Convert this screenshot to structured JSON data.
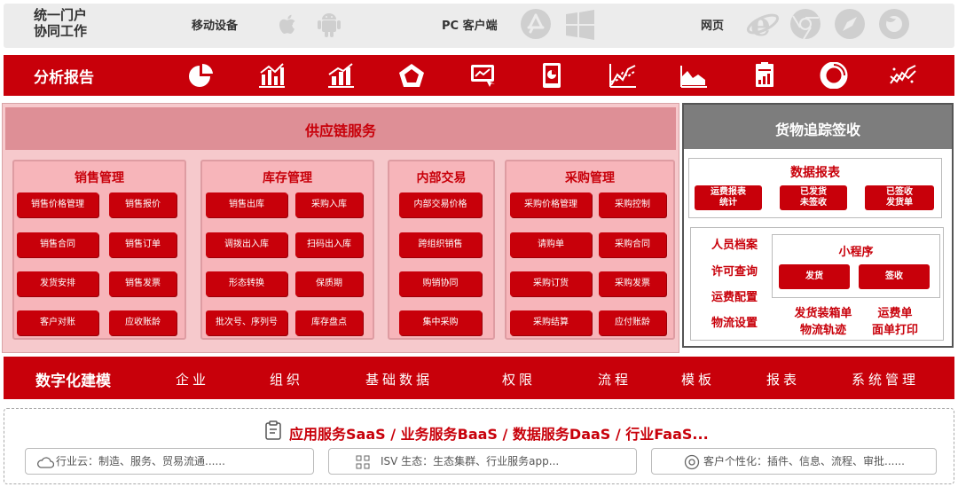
{
  "portal": {
    "title_line1": "统一门户",
    "title_line2": "协同工作",
    "categories": [
      {
        "label": "移动设备",
        "icons": [
          "apple-icon",
          "android-icon"
        ]
      },
      {
        "label": "PC 客户端",
        "icons": [
          "app-store-icon",
          "windows-icon"
        ]
      },
      {
        "label": "网页",
        "icons": [
          "ie-icon",
          "chrome-icon",
          "safari-icon",
          "firefox-icon"
        ]
      }
    ]
  },
  "analysis": {
    "title": "分析报告",
    "icons": [
      "pie-chart-icon",
      "bar-line-icon",
      "bar-trend-icon",
      "radar-chart-icon",
      "dashboard-screen-icon",
      "tablet-chart-icon",
      "multi-line-chart-icon",
      "area-chart-icon",
      "report-doc-icon",
      "ring-chart-icon",
      "scatter-line-icon"
    ]
  },
  "supply_chain": {
    "title": "供应链服务",
    "groups": [
      {
        "title": "销售管理",
        "items": [
          "销售价格管理",
          "销售报价",
          "销售合同",
          "销售订单",
          "发货安排",
          "销售发票",
          "客户对账",
          "应收账龄"
        ]
      },
      {
        "title": "库存管理",
        "items": [
          "销售出库",
          "采购入库",
          "调拨出入库",
          "扫码出入库",
          "形态转换",
          "保质期",
          "批次号、序列号",
          "库存盘点"
        ]
      },
      {
        "title": "内部交易",
        "items": [
          "内部交易价格",
          "跨组织销售",
          "购销协同",
          "集中采购"
        ]
      },
      {
        "title": "采购管理",
        "items": [
          "采购价格管理",
          "采购控制",
          "请购单",
          "采购合同",
          "采购订货",
          "采购发票",
          "采购结算",
          "应付账龄"
        ]
      }
    ]
  },
  "tracking": {
    "title": "货物追踪签收",
    "report": {
      "title": "数据报表",
      "buttons": [
        {
          "line1": "运费报表",
          "line2": "统计"
        },
        {
          "line1": "已发货",
          "line2": "未签收"
        },
        {
          "line1": "已签收",
          "line2": "发货单"
        }
      ]
    },
    "left_items": [
      "人员档案",
      "许可查询",
      "运费配置",
      "物流设置"
    ],
    "mini_program": {
      "title": "小程序",
      "buttons": [
        "发货",
        "签收"
      ]
    },
    "bottom": [
      {
        "line1": "发货装箱单",
        "line2": "物流轨迹"
      },
      {
        "line1": "运费单",
        "line2": "面单打印"
      }
    ]
  },
  "digital": {
    "title": "数字化建模",
    "items": [
      "企业",
      "组织",
      "基础数据",
      "权限",
      "流程",
      "模板",
      "报表",
      "系统管理"
    ]
  },
  "services": {
    "title": "应用服务SaaS / 业务服务BaaS / 数据服务DaaS / 行业FaaS...",
    "pills": [
      {
        "icon": "cloud-icon",
        "text": "行业云：制造、服务、贸易流通......"
      },
      {
        "icon": "grid-icon",
        "text": "ISV 生态：生态集群、行业服务app..."
      },
      {
        "icon": "personalize-icon",
        "text": "客户个性化：插件、信息、流程、审批......"
      }
    ]
  },
  "colors": {
    "accent": "#c8000a",
    "pink": "#f6c9cc",
    "gray": "#7d7d7d"
  }
}
